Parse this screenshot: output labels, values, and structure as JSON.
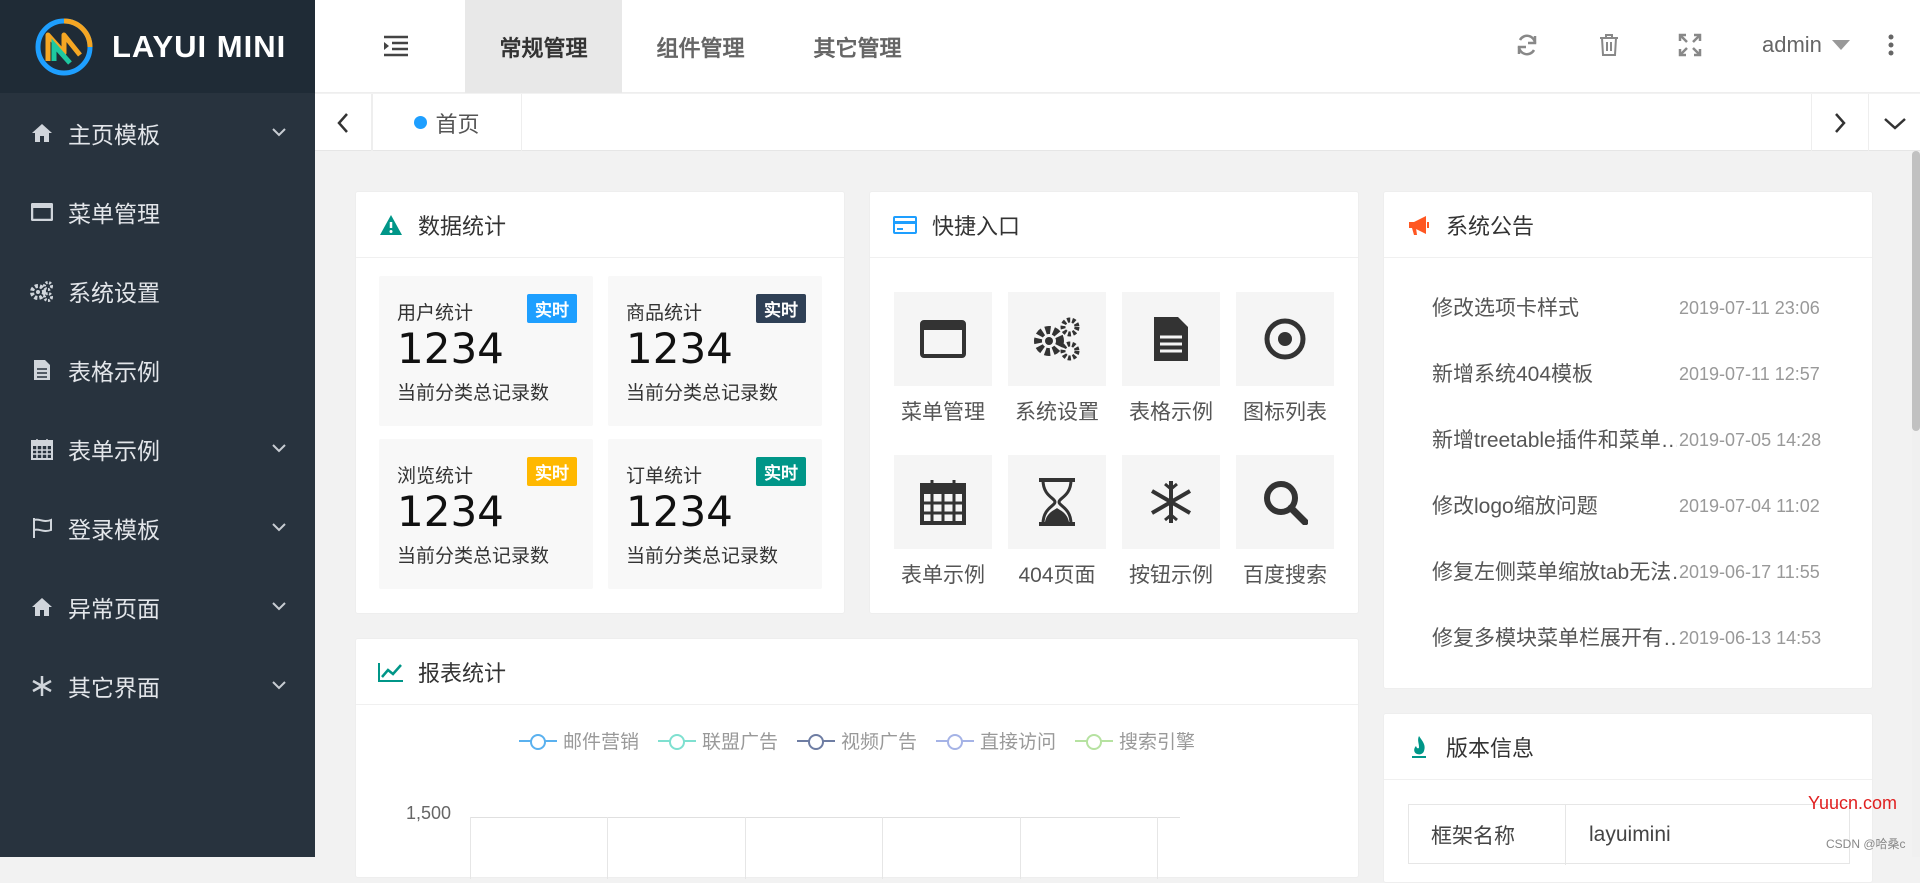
{
  "app": {
    "logo_text": "LAYUI MINI"
  },
  "sidebar": {
    "items": [
      {
        "label": "主页模板",
        "icon": "home-icon",
        "has_arrow": true
      },
      {
        "label": "菜单管理",
        "icon": "window-icon",
        "has_arrow": false
      },
      {
        "label": "系统设置",
        "icon": "gears-icon",
        "has_arrow": false
      },
      {
        "label": "表格示例",
        "icon": "file-icon",
        "has_arrow": false
      },
      {
        "label": "表单示例",
        "icon": "calendar-icon",
        "has_arrow": true
      },
      {
        "label": "登录模板",
        "icon": "flag-icon",
        "has_arrow": true
      },
      {
        "label": "异常页面",
        "icon": "home-icon",
        "has_arrow": true
      },
      {
        "label": "其它界面",
        "icon": "snowflake-icon",
        "has_arrow": true
      }
    ]
  },
  "header": {
    "tabs": [
      {
        "label": "常规管理",
        "active": true
      },
      {
        "label": "组件管理",
        "active": false
      },
      {
        "label": "其它管理",
        "active": false
      }
    ],
    "user": "admin"
  },
  "tabbar": {
    "home_label": "首页"
  },
  "stats": {
    "title": "数据统计",
    "items": [
      {
        "label": "用户统计",
        "badge": "实时",
        "badge_color": "#1e9fff",
        "value": "1234",
        "sub": "当前分类总记录数"
      },
      {
        "label": "商品统计",
        "badge": "实时",
        "badge_color": "#2f4056",
        "value": "1234",
        "sub": "当前分类总记录数"
      },
      {
        "label": "浏览统计",
        "badge": "实时",
        "badge_color": "#ffb800",
        "value": "1234",
        "sub": "当前分类总记录数"
      },
      {
        "label": "订单统计",
        "badge": "实时",
        "badge_color": "#009688",
        "value": "1234",
        "sub": "当前分类总记录数"
      }
    ]
  },
  "quick": {
    "title": "快捷入口",
    "items": [
      {
        "label": "菜单管理",
        "icon": "window-icon"
      },
      {
        "label": "系统设置",
        "icon": "gears-icon"
      },
      {
        "label": "表格示例",
        "icon": "file-icon"
      },
      {
        "label": "图标列表",
        "icon": "dot-circle-icon"
      },
      {
        "label": "表单示例",
        "icon": "calendar-icon"
      },
      {
        "label": "404页面",
        "icon": "hourglass-icon"
      },
      {
        "label": "按钮示例",
        "icon": "snowflake-icon"
      },
      {
        "label": "百度搜索",
        "icon": "search-icon"
      }
    ]
  },
  "notices": {
    "title": "系统公告",
    "items": [
      {
        "title": "修改选项卡样式",
        "date": "2019-07-11 23:06"
      },
      {
        "title": "新增系统404模板",
        "date": "2019-07-11 12:57"
      },
      {
        "title": "新增treetable插件和菜单…",
        "date": "2019-07-05 14:28"
      },
      {
        "title": "修改logo缩放问题",
        "date": "2019-07-04 11:02"
      },
      {
        "title": "修复左侧菜单缩放tab无法…",
        "date": "2019-06-17 11:55"
      },
      {
        "title": "修复多模块菜单栏展开有…",
        "date": "2019-06-13 14:53"
      }
    ]
  },
  "report": {
    "title": "报表统计",
    "legend": [
      {
        "name": "邮件营销",
        "color": "#5ab1ef"
      },
      {
        "name": "联盟广告",
        "color": "#7fe0d0"
      },
      {
        "name": "视频广告",
        "color": "#6e7da3"
      },
      {
        "name": "直接访问",
        "color": "#a5b3e6"
      },
      {
        "name": "搜索引擎",
        "color": "#b6e2a1"
      }
    ],
    "y_tick": "1,500"
  },
  "version": {
    "title": "版本信息",
    "rows": [
      {
        "key": "框架名称",
        "value": "layuimini"
      }
    ]
  },
  "watermark": {
    "site": "Yuucn.com",
    "credit": "CSDN @哈桑c"
  },
  "colors": {
    "sidebar": "#28333e",
    "logo_bg": "#1f2b36",
    "accent": "#1e9fff",
    "green": "#009688"
  }
}
